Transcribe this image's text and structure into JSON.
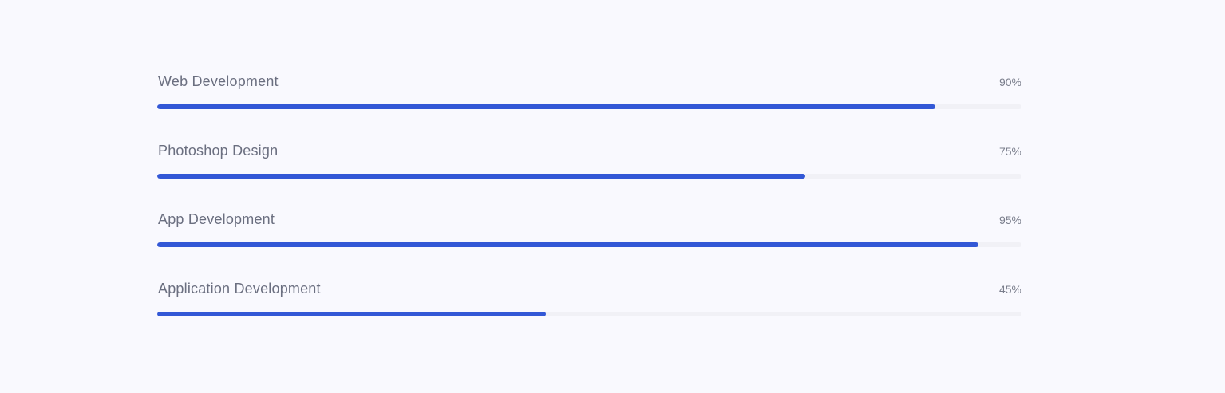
{
  "colors": {
    "background": "#f9f9fe",
    "track": "#f1f1f6",
    "fill": "#3358d6",
    "label": "#6b6f80"
  },
  "skills": [
    {
      "label": "Web Development",
      "percent_text": "90%",
      "value": 90
    },
    {
      "label": "Photoshop Design",
      "percent_text": "75%",
      "value": 75
    },
    {
      "label": "App Development",
      "percent_text": "95%",
      "value": 95
    },
    {
      "label": "Application Development",
      "percent_text": "45%",
      "value": 45
    }
  ]
}
